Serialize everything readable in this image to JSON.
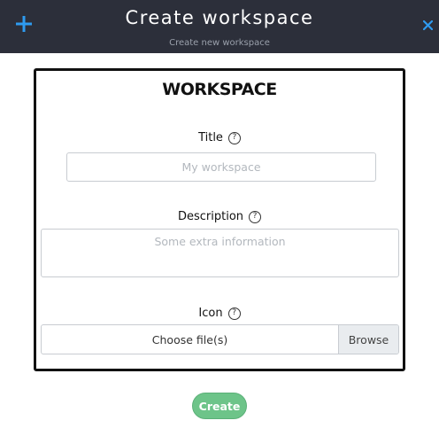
{
  "header": {
    "title": "Create workspace",
    "subtitle": "Create new workspace",
    "add_icon": "plus-icon",
    "close_icon": "close-icon",
    "background_color": "#2c2f3a",
    "accent_color": "#2e9bf0"
  },
  "form": {
    "title": "WORKSPACE",
    "title_field": {
      "label": "Title",
      "help_glyph": "?",
      "placeholder": "My workspace",
      "value": ""
    },
    "description_field": {
      "label": "Description",
      "help_glyph": "?",
      "placeholder": "Some extra information",
      "value": ""
    },
    "icon_field": {
      "label": "Icon",
      "help_glyph": "?",
      "choose_label": "Choose file(s)",
      "browse_label": "Browse"
    }
  },
  "actions": {
    "create_label": "Create",
    "create_color": "#6dc489"
  }
}
